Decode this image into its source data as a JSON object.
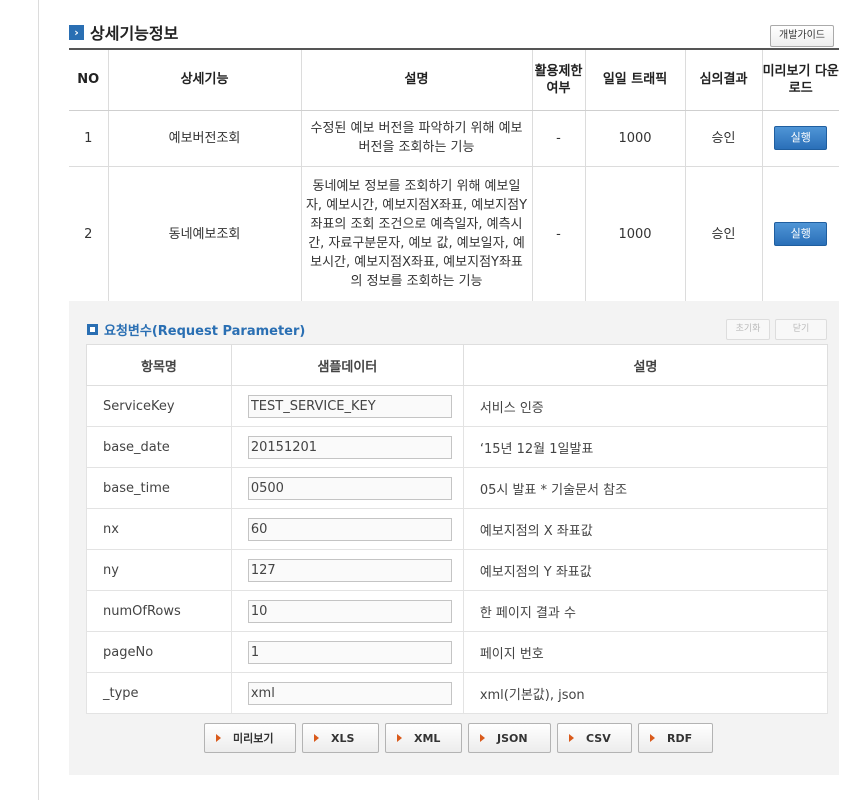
{
  "section": {
    "icon": "chevron-right-icon",
    "title": "상세기능정보",
    "guide_button": "개발가이드"
  },
  "main_table": {
    "headers": [
      "NO",
      "상세기능",
      "설명",
      "활용제한 여부",
      "일일 트래픽",
      "심의결과",
      "미리보기 다운로드"
    ],
    "rows": [
      {
        "no": "1",
        "name": "예보버전조회",
        "desc": "수정된 예보 버전을 파악하기 위해 예보버전을 조회하는 기능",
        "limit": "-",
        "traffic": "1000",
        "result": "승인",
        "action": "실행"
      },
      {
        "no": "2",
        "name": "동네예보조회",
        "desc": "동네예보 정보를 조회하기 위해 예보일자, 예보시간, 예보지점X좌표, 예보지점Y좌표의 조회 조건으로 예측일자, 예측시간, 자료구분문자, 예보 값, 예보일자, 예보시간, 예보지점X좌표, 예보지점Y좌표의 정보를 조회하는 기능",
        "limit": "-",
        "traffic": "1000",
        "result": "승인",
        "action": "실행"
      }
    ]
  },
  "params": {
    "title": "요청변수(Request Parameter)",
    "reset_button": "초기화",
    "close_button": "닫기",
    "headers": [
      "항목명",
      "샘플데이터",
      "설명"
    ],
    "rows": [
      {
        "name": "ServiceKey",
        "sample": "TEST_SERVICE_KEY",
        "desc": "서비스 인증"
      },
      {
        "name": "base_date",
        "sample": "20151201",
        "desc": "‘15년 12월 1일발표"
      },
      {
        "name": "base_time",
        "sample": "0500",
        "desc": "05시 발표 * 기술문서 참조"
      },
      {
        "name": "nx",
        "sample": "60",
        "desc": "예보지점의 X 좌표값"
      },
      {
        "name": "ny",
        "sample": "127",
        "desc": "예보지점의 Y 좌표값"
      },
      {
        "name": "numOfRows",
        "sample": "10",
        "desc": "한 페이지 결과 수"
      },
      {
        "name": "pageNo",
        "sample": "1",
        "desc": "페이지 번호"
      },
      {
        "name": "_type",
        "sample": "xml",
        "desc": "xml(기본값), json"
      }
    ]
  },
  "format_buttons": [
    "미리보기",
    "XLS",
    "XML",
    "JSON",
    "CSV",
    "RDF"
  ],
  "colors": {
    "accent": "#2a6fb3",
    "run_button": "#2a6fb8",
    "arrow": "#d95a1b",
    "panel_bg": "#f3f3f3"
  }
}
